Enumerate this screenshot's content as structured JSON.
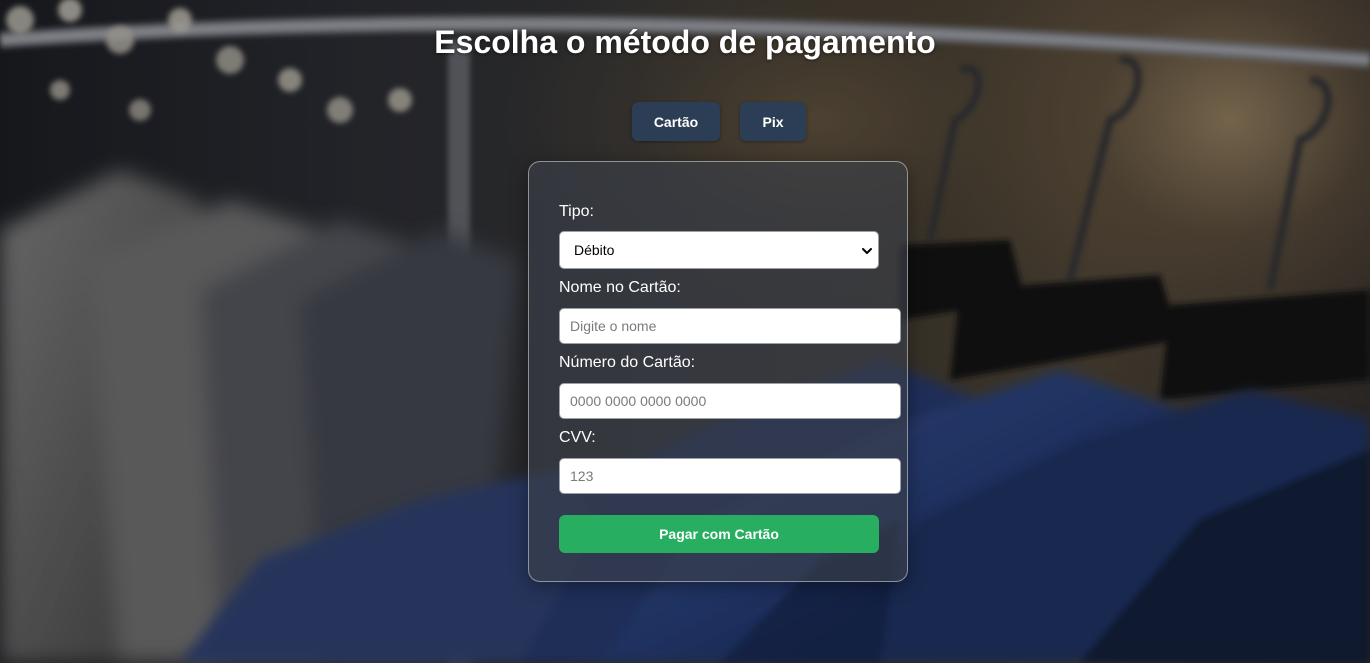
{
  "page": {
    "title": "Escolha o método de pagamento"
  },
  "tabs": [
    {
      "label": "Cartão"
    },
    {
      "label": "Pix"
    }
  ],
  "form": {
    "type": {
      "label": "Tipo:",
      "selected": "Débito"
    },
    "name": {
      "label": "Nome no Cartão:",
      "value": "",
      "placeholder": "Digite o nome"
    },
    "number": {
      "label": "Número do Cartão:",
      "value": "",
      "placeholder": "0000 0000 0000 0000"
    },
    "cvv": {
      "label": "CVV:",
      "value": "",
      "placeholder": "123"
    },
    "submit_label": "Pagar com Cartão"
  },
  "colors": {
    "tab_button": "#2c3e55",
    "submit_button": "#27ae60",
    "title_text": "#ffffff"
  },
  "icons": {
    "select_arrow": "chevron-down-icon"
  }
}
